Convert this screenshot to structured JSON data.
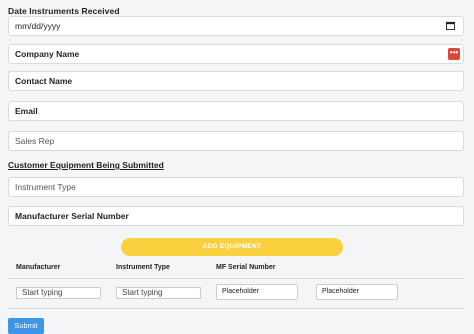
{
  "form": {
    "date_label": "Date Instruments Received",
    "date_value": "mm/dd/yyyy",
    "company_placeholder": "Company Name",
    "contact_placeholder": "Contact Name",
    "email_placeholder": "Email",
    "sales_rep_placeholder": "Sales Rep",
    "section_title": "Customer Equipment Being Submitted",
    "instrument_type_placeholder": "Instrument Type",
    "serial_placeholder": "Manufacturer Serial Number",
    "add_button": "ADD EQUIPMENT",
    "submit_label": "Submit"
  },
  "table": {
    "headers": [
      "Manufacturer",
      "Instrument Type",
      "MF Serial Number"
    ],
    "row": {
      "manufacturer": "Start typing",
      "instrument_type": "Start typing",
      "serial_1": "Placeholder",
      "serial_2": "Placeholder"
    }
  },
  "icons": {
    "calendar": "calendar-icon",
    "autofill": "more-options-icon"
  },
  "colors": {
    "accent_button": "#f9d13e",
    "submit_button": "#3d95e8",
    "autofill_icon": "#d9483b"
  }
}
